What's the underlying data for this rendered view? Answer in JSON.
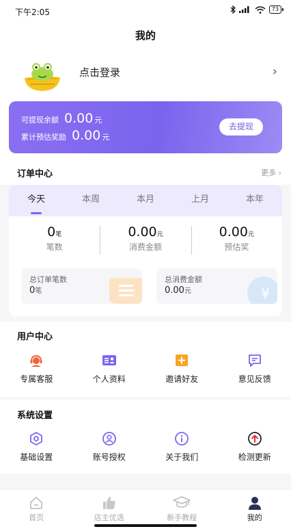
{
  "status_bar": {
    "time": "下午2:05",
    "battery": "73"
  },
  "header": {
    "title": "我的"
  },
  "profile": {
    "login_text": "点击登录",
    "avatar_icon": "frog-mascot-icon",
    "chevron_icon": "chevron-right-icon"
  },
  "balance": {
    "withdrawable_label": "可提现余额",
    "withdrawable_value": "0.00",
    "withdrawable_unit": "元",
    "estimated_label": "累计预估奖励",
    "estimated_value": "0.00",
    "estimated_unit": "元",
    "withdraw_button": "去提现",
    "accent_color": "#7b66ee"
  },
  "order_center": {
    "title": "订单中心",
    "more": "更多",
    "tabs": [
      {
        "label": "今天",
        "active": true
      },
      {
        "label": "本周",
        "active": false
      },
      {
        "label": "本月",
        "active": false
      },
      {
        "label": "上月",
        "active": false
      },
      {
        "label": "本年",
        "active": false
      }
    ],
    "stats": [
      {
        "value": "0",
        "unit": "笔",
        "label": "笔数"
      },
      {
        "value": "0.00",
        "unit": "元",
        "label": "消费金额"
      },
      {
        "value": "0.00",
        "unit": "元",
        "label": "预估奖"
      }
    ],
    "summary": [
      {
        "label": "总订单笔数",
        "value": "0",
        "unit": "笔",
        "icon": "order-list-icon"
      },
      {
        "label": "总消费金额",
        "value": "0.00",
        "unit": "元",
        "icon": "yuan-coin-icon"
      }
    ]
  },
  "user_center": {
    "title": "用户中心",
    "items": [
      {
        "label": "专属客服",
        "icon": "customer-service-icon",
        "color": "#f0643c"
      },
      {
        "label": "个人资料",
        "icon": "profile-card-icon",
        "color": "#7b66ee"
      },
      {
        "label": "邀请好友",
        "icon": "invite-plus-icon",
        "color": "#f5a623"
      },
      {
        "label": "意见反馈",
        "icon": "feedback-icon",
        "color": "#7b66ee"
      }
    ]
  },
  "system_settings": {
    "title": "系统设置",
    "items": [
      {
        "label": "基础设置",
        "icon": "settings-icon"
      },
      {
        "label": "账号授权",
        "icon": "account-auth-icon"
      },
      {
        "label": "关于我们",
        "icon": "info-icon"
      },
      {
        "label": "检测更新",
        "icon": "update-icon",
        "color": "#e03030"
      }
    ]
  },
  "tab_bar": {
    "items": [
      {
        "label": "首页",
        "icon": "home-icon",
        "active": false
      },
      {
        "label": "店主优选",
        "icon": "thumbs-up-icon",
        "active": false
      },
      {
        "label": "新手教程",
        "icon": "graduation-cap-icon",
        "active": false
      },
      {
        "label": "我的",
        "icon": "user-icon",
        "active": true
      }
    ]
  }
}
